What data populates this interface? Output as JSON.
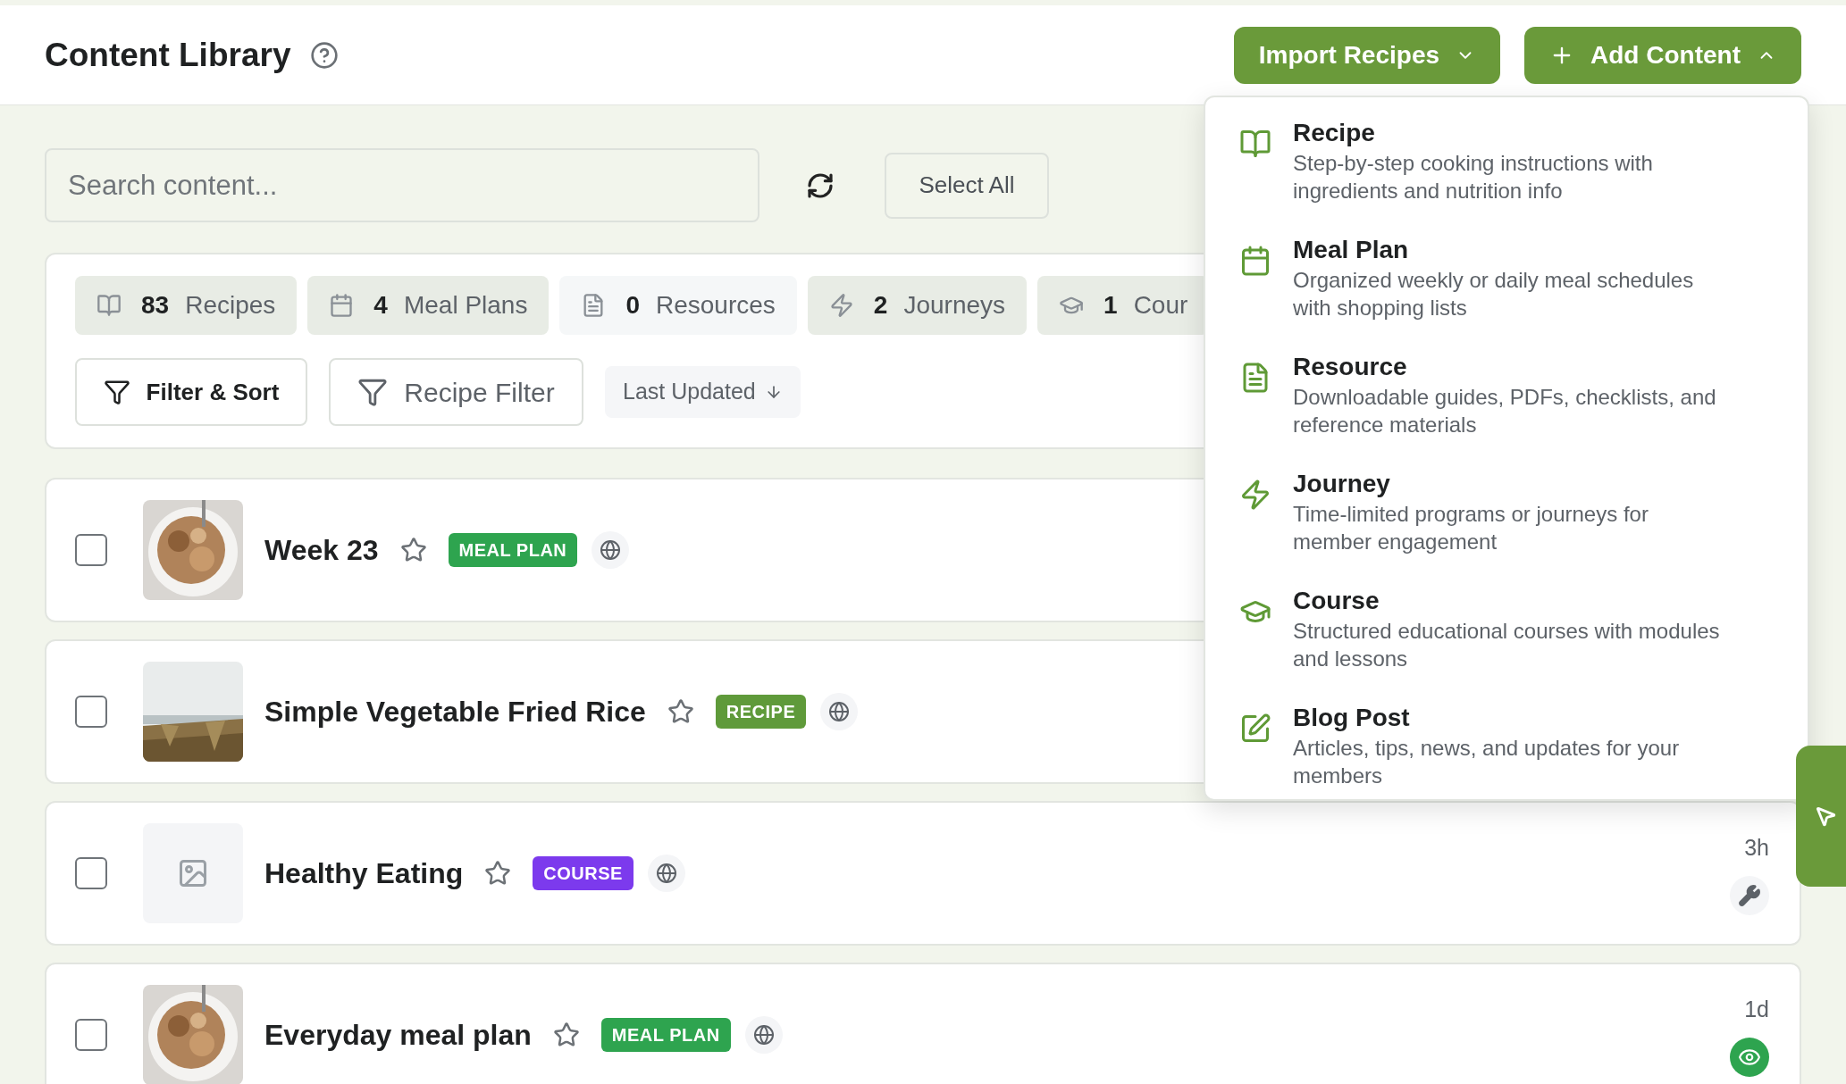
{
  "header": {
    "title": "Content Library",
    "buttons": [
      {
        "label": "Import Recipes",
        "kind": "dropdown",
        "expanded": false
      },
      {
        "label": "Add Content",
        "kind": "add",
        "expanded": true
      }
    ]
  },
  "search": {
    "placeholder": "Search content..."
  },
  "select_all": "Select All",
  "stats": [
    {
      "count": "83",
      "label": "Recipes",
      "kind": "book",
      "selected": true
    },
    {
      "count": "4",
      "label": "Meal Plans",
      "kind": "calendar",
      "selected": true
    },
    {
      "count": "0",
      "label": "Resources",
      "kind": "file",
      "selected": false
    },
    {
      "count": "2",
      "label": "Journeys",
      "kind": "bolt",
      "selected": true
    },
    {
      "count": "1",
      "label": "Cour",
      "kind": "cap",
      "selected": true
    }
  ],
  "filters": {
    "filter_sort": "Filter & Sort",
    "recipe_filter": "Recipe Filter",
    "sort": "Last Updated"
  },
  "rows": [
    {
      "title": "Week 23",
      "starred": false,
      "badge": {
        "label": "MEAL PLAN",
        "color": "#2ea44f"
      },
      "checked": false
    },
    {
      "title": "Simple Vegetable Fried Rice",
      "starred": false,
      "badge": {
        "label": "RECIPE",
        "color": "#5f9a3a"
      },
      "checked": false
    },
    {
      "title": "Healthy Eating",
      "starred": false,
      "badge": {
        "label": "COURSE",
        "color": "#7c3aed"
      },
      "image": {
        "kind": "placeholder"
      },
      "checked": false,
      "time": "3h",
      "published": false
    },
    {
      "title": "Everyday meal plan",
      "starred": false,
      "badge": {
        "label": "MEAL PLAN",
        "color": "#2ea44f"
      },
      "checked": false,
      "time": "1d",
      "published": true
    }
  ],
  "menu": [
    {
      "title": "Recipe",
      "description": "Step-by-step cooking instructions with ingredients and nutrition info",
      "kind": "book"
    },
    {
      "title": "Meal Plan",
      "description": "Organized weekly or daily meal schedules with shopping lists",
      "kind": "calendar"
    },
    {
      "title": "Resource",
      "description": "Downloadable guides, PDFs, checklists, and reference materials",
      "kind": "file"
    },
    {
      "title": "Journey",
      "description": "Time-limited programs or journeys for member engagement",
      "kind": "bolt"
    },
    {
      "title": "Course",
      "description": "Structured educational courses with modules and lessons",
      "kind": "cap"
    },
    {
      "title": "Blog Post",
      "description": "Articles, tips, news, and updates for your members",
      "kind": "edit"
    }
  ]
}
